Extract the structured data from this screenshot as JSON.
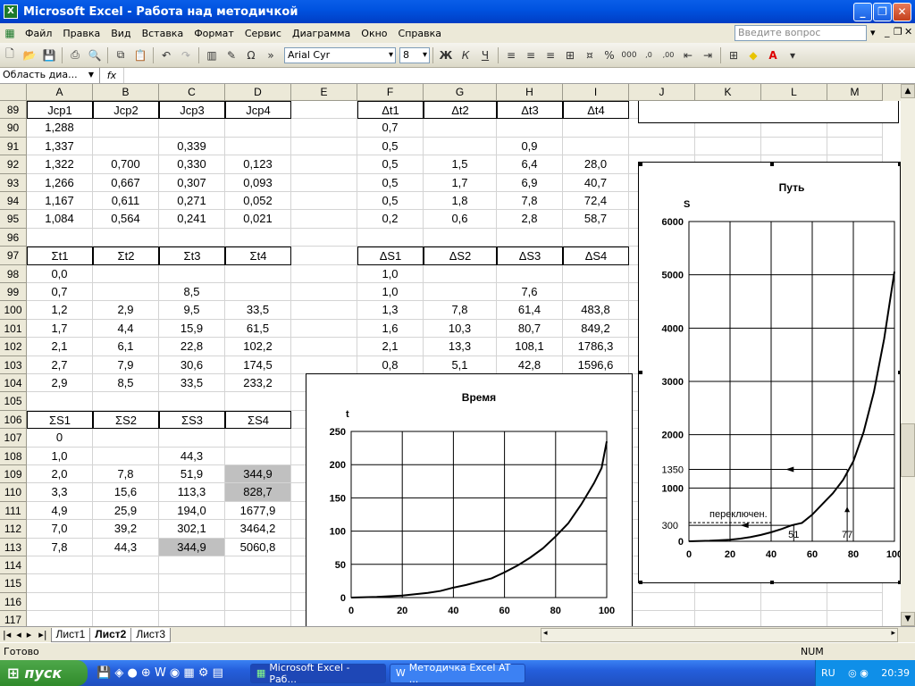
{
  "window": {
    "title": "Microsoft Excel - Работа над методичкой",
    "min": "_",
    "max": "❐",
    "close": "✕"
  },
  "menu": [
    "Файл",
    "Правка",
    "Вид",
    "Вставка",
    "Формат",
    "Сервис",
    "Диаграмма",
    "Окно",
    "Справка"
  ],
  "ask_placeholder": "Введите вопрос",
  "toolbar": {
    "font": "Arial Cyr",
    "size": "8"
  },
  "namebox": "Область диа...",
  "fx": "fx",
  "columns": [
    "A",
    "B",
    "C",
    "D",
    "E",
    "F",
    "G",
    "H",
    "I",
    "J",
    "K",
    "L",
    "M"
  ],
  "rows": [
    {
      "n": "89",
      "a": "Jcp1",
      "b": "Jcp2",
      "c": "Jcp3",
      "d": "Jcp4",
      "f": "Δt1",
      "g": "Δt2",
      "h": "Δt3",
      "i": "Δt4"
    },
    {
      "n": "90",
      "a": "1,288",
      "b": "",
      "c": "",
      "d": "",
      "f": "0,7",
      "g": "",
      "h": "",
      "i": ""
    },
    {
      "n": "91",
      "a": "1,337",
      "b": "",
      "c": "0,339",
      "d": "",
      "f": "0,5",
      "g": "",
      "h": "0,9",
      "i": ""
    },
    {
      "n": "92",
      "a": "1,322",
      "b": "0,700",
      "c": "0,330",
      "d": "0,123",
      "f": "0,5",
      "g": "1,5",
      "h": "6,4",
      "i": "28,0"
    },
    {
      "n": "93",
      "a": "1,266",
      "b": "0,667",
      "c": "0,307",
      "d": "0,093",
      "f": "0,5",
      "g": "1,7",
      "h": "6,9",
      "i": "40,7"
    },
    {
      "n": "94",
      "a": "1,167",
      "b": "0,611",
      "c": "0,271",
      "d": "0,052",
      "f": "0,5",
      "g": "1,8",
      "h": "7,8",
      "i": "72,4"
    },
    {
      "n": "95",
      "a": "1,084",
      "b": "0,564",
      "c": "0,241",
      "d": "0,021",
      "f": "0,2",
      "g": "0,6",
      "h": "2,8",
      "i": "58,7"
    },
    {
      "n": "96",
      "a": "",
      "b": "",
      "c": "",
      "d": "",
      "f": "",
      "g": "",
      "h": "",
      "i": ""
    },
    {
      "n": "97",
      "a": "Σt1",
      "b": "Σt2",
      "c": "Σt3",
      "d": "Σt4",
      "f": "ΔS1",
      "g": "ΔS2",
      "h": "ΔS3",
      "i": "ΔS4"
    },
    {
      "n": "98",
      "a": "0,0",
      "b": "",
      "c": "",
      "d": "",
      "f": "1,0",
      "g": "",
      "h": "",
      "i": ""
    },
    {
      "n": "99",
      "a": "0,7",
      "b": "",
      "c": "8,5",
      "d": "",
      "f": "1,0",
      "g": "",
      "h": "7,6",
      "i": ""
    },
    {
      "n": "100",
      "a": "1,2",
      "b": "2,9",
      "c": "9,5",
      "d": "33,5",
      "f": "1,3",
      "g": "7,8",
      "h": "61,4",
      "i": "483,8"
    },
    {
      "n": "101",
      "a": "1,7",
      "b": "4,4",
      "c": "15,9",
      "d": "61,5",
      "f": "1,6",
      "g": "10,3",
      "h": "80,7",
      "i": "849,2"
    },
    {
      "n": "102",
      "a": "2,1",
      "b": "6,1",
      "c": "22,8",
      "d": "102,2",
      "f": "2,1",
      "g": "13,3",
      "h": "108,1",
      "i": "1786,3"
    },
    {
      "n": "103",
      "a": "2,7",
      "b": "7,9",
      "c": "30,6",
      "d": "174,5",
      "f": "0,8",
      "g": "5,1",
      "h": "42,8",
      "i": "1596,6"
    },
    {
      "n": "104",
      "a": "2,9",
      "b": "8,5",
      "c": "33,5",
      "d": "233,2"
    },
    {
      "n": "105",
      "a": "",
      "b": "",
      "c": "",
      "d": ""
    },
    {
      "n": "106",
      "a": "ΣS1",
      "b": "ΣS2",
      "c": "ΣS3",
      "d": "ΣS4"
    },
    {
      "n": "107",
      "a": "0",
      "b": "",
      "c": "",
      "d": ""
    },
    {
      "n": "108",
      "a": "1,0",
      "b": "",
      "c": "44,3",
      "d": ""
    },
    {
      "n": "109",
      "a": "2,0",
      "b": "7,8",
      "c": "51,9",
      "d": "344,9"
    },
    {
      "n": "110",
      "a": "3,3",
      "b": "15,6",
      "c": "113,3",
      "d": "828,7"
    },
    {
      "n": "111",
      "a": "4,9",
      "b": "25,9",
      "c": "194,0",
      "d": "1677,9"
    },
    {
      "n": "112",
      "a": "7,0",
      "b": "39,2",
      "c": "302,1",
      "d": "3464,2"
    },
    {
      "n": "113",
      "a": "7,8",
      "b": "44,3",
      "c": "344,9",
      "d": "5060,8"
    },
    {
      "n": "114"
    },
    {
      "n": "115"
    },
    {
      "n": "116"
    },
    {
      "n": "117"
    }
  ],
  "sheets": [
    "Лист1",
    "Лист2",
    "Лист3"
  ],
  "status": {
    "left": "Готово",
    "num": "NUM"
  },
  "taskbar": {
    "start": "пуск",
    "task1": "Microsoft Excel - Раб...",
    "task2": "Методичка Excel AT ...",
    "lang": "RU",
    "time": "20:39"
  },
  "chart_data": [
    {
      "type": "line",
      "title": "Время",
      "ylabel": "t",
      "xlim": [
        0,
        100
      ],
      "ylim": [
        0,
        250
      ],
      "xticks": [
        0,
        20,
        40,
        60,
        80,
        100
      ],
      "yticks": [
        0,
        50,
        100,
        150,
        200,
        250
      ],
      "x": [
        0,
        5,
        10,
        15,
        20,
        25,
        30,
        35,
        40,
        45,
        50,
        55,
        60,
        65,
        70,
        75,
        80,
        85,
        90,
        95,
        98,
        100
      ],
      "values": [
        0,
        0.5,
        1,
        2,
        3,
        5,
        7,
        10,
        15,
        19,
        24,
        29,
        38,
        48,
        60,
        74,
        92,
        112,
        140,
        172,
        195,
        235
      ]
    },
    {
      "type": "line",
      "title": "Путь",
      "ylabel": "S",
      "xlim": [
        0,
        100
      ],
      "ylim": [
        0,
        6000
      ],
      "xticks": [
        0,
        20,
        40,
        60,
        80,
        100
      ],
      "yticks": [
        0,
        1000,
        2000,
        3000,
        4000,
        5000,
        6000
      ],
      "x": [
        0,
        10,
        20,
        25,
        30,
        35,
        40,
        45,
        50,
        55,
        60,
        65,
        70,
        75,
        80,
        85,
        90,
        95,
        100
      ],
      "values": [
        0,
        10,
        30,
        50,
        80,
        120,
        170,
        230,
        300,
        345,
        500,
        700,
        900,
        1150,
        1500,
        2050,
        2800,
        3800,
        5060
      ],
      "annotations": [
        {
          "text": "1350",
          "y": 1350
        },
        {
          "text": "300",
          "y": 300
        },
        {
          "text": "переключен.",
          "x": 10,
          "y": 450
        },
        {
          "text": "51",
          "x": 51,
          "y": 0
        },
        {
          "text": "77",
          "x": 77,
          "y": 0
        }
      ]
    }
  ]
}
